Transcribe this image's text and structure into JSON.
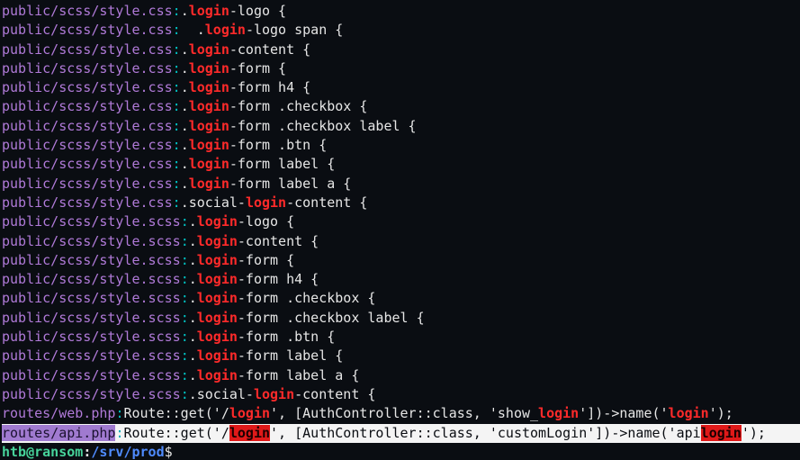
{
  "terminal": {
    "lines": [
      {
        "file": "public/scss/style.css",
        "sep": ":",
        "segments": [
          {
            "t": "."
          },
          {
            "t": "login",
            "m": true
          },
          {
            "t": "-logo {"
          }
        ]
      },
      {
        "file": "public/scss/style.css",
        "sep": ":",
        "segments": [
          {
            "t": "  ."
          },
          {
            "t": "login",
            "m": true
          },
          {
            "t": "-logo span {"
          }
        ]
      },
      {
        "file": "public/scss/style.css",
        "sep": ":",
        "segments": [
          {
            "t": "."
          },
          {
            "t": "login",
            "m": true
          },
          {
            "t": "-content {"
          }
        ]
      },
      {
        "file": "public/scss/style.css",
        "sep": ":",
        "segments": [
          {
            "t": "."
          },
          {
            "t": "login",
            "m": true
          },
          {
            "t": "-form {"
          }
        ]
      },
      {
        "file": "public/scss/style.css",
        "sep": ":",
        "segments": [
          {
            "t": "."
          },
          {
            "t": "login",
            "m": true
          },
          {
            "t": "-form h4 {"
          }
        ]
      },
      {
        "file": "public/scss/style.css",
        "sep": ":",
        "segments": [
          {
            "t": "."
          },
          {
            "t": "login",
            "m": true
          },
          {
            "t": "-form .checkbox {"
          }
        ]
      },
      {
        "file": "public/scss/style.css",
        "sep": ":",
        "segments": [
          {
            "t": "."
          },
          {
            "t": "login",
            "m": true
          },
          {
            "t": "-form .checkbox label {"
          }
        ]
      },
      {
        "file": "public/scss/style.css",
        "sep": ":",
        "segments": [
          {
            "t": "."
          },
          {
            "t": "login",
            "m": true
          },
          {
            "t": "-form .btn {"
          }
        ]
      },
      {
        "file": "public/scss/style.css",
        "sep": ":",
        "segments": [
          {
            "t": "."
          },
          {
            "t": "login",
            "m": true
          },
          {
            "t": "-form label {"
          }
        ]
      },
      {
        "file": "public/scss/style.css",
        "sep": ":",
        "segments": [
          {
            "t": "."
          },
          {
            "t": "login",
            "m": true
          },
          {
            "t": "-form label a {"
          }
        ]
      },
      {
        "file": "public/scss/style.css",
        "sep": ":",
        "segments": [
          {
            "t": ".social-"
          },
          {
            "t": "login",
            "m": true
          },
          {
            "t": "-content {"
          }
        ]
      },
      {
        "file": "public/scss/style.scss",
        "sep": ":",
        "segments": [
          {
            "t": "."
          },
          {
            "t": "login",
            "m": true
          },
          {
            "t": "-logo {"
          }
        ]
      },
      {
        "file": "public/scss/style.scss",
        "sep": ":",
        "segments": [
          {
            "t": "."
          },
          {
            "t": "login",
            "m": true
          },
          {
            "t": "-content {"
          }
        ]
      },
      {
        "file": "public/scss/style.scss",
        "sep": ":",
        "segments": [
          {
            "t": "."
          },
          {
            "t": "login",
            "m": true
          },
          {
            "t": "-form {"
          }
        ]
      },
      {
        "file": "public/scss/style.scss",
        "sep": ":",
        "segments": [
          {
            "t": "."
          },
          {
            "t": "login",
            "m": true
          },
          {
            "t": "-form h4 {"
          }
        ]
      },
      {
        "file": "public/scss/style.scss",
        "sep": ":",
        "segments": [
          {
            "t": "."
          },
          {
            "t": "login",
            "m": true
          },
          {
            "t": "-form .checkbox {"
          }
        ]
      },
      {
        "file": "public/scss/style.scss",
        "sep": ":",
        "segments": [
          {
            "t": "."
          },
          {
            "t": "login",
            "m": true
          },
          {
            "t": "-form .checkbox label {"
          }
        ]
      },
      {
        "file": "public/scss/style.scss",
        "sep": ":",
        "segments": [
          {
            "t": "."
          },
          {
            "t": "login",
            "m": true
          },
          {
            "t": "-form .btn {"
          }
        ]
      },
      {
        "file": "public/scss/style.scss",
        "sep": ":",
        "segments": [
          {
            "t": "."
          },
          {
            "t": "login",
            "m": true
          },
          {
            "t": "-form label {"
          }
        ]
      },
      {
        "file": "public/scss/style.scss",
        "sep": ":",
        "segments": [
          {
            "t": "."
          },
          {
            "t": "login",
            "m": true
          },
          {
            "t": "-form label a {"
          }
        ]
      },
      {
        "file": "public/scss/style.scss",
        "sep": ":",
        "segments": [
          {
            "t": ".social-"
          },
          {
            "t": "login",
            "m": true
          },
          {
            "t": "-content {"
          }
        ]
      },
      {
        "file": "routes/web.php",
        "sep": ":",
        "segments": [
          {
            "t": "Route::get('/"
          },
          {
            "t": "login",
            "m": true
          },
          {
            "t": "', [AuthController::class, 'show_"
          },
          {
            "t": "login",
            "m": true
          },
          {
            "t": "'])->name('"
          },
          {
            "t": "login",
            "m": true
          },
          {
            "t": "');"
          }
        ]
      },
      {
        "file": "routes/api.php",
        "sep": ":",
        "highlight": true,
        "segments": [
          {
            "t": "Route::get('/"
          },
          {
            "t": "login",
            "m": true
          },
          {
            "t": "', [AuthController::class, 'customLogin'])->name('api"
          },
          {
            "t": "login",
            "m": true
          },
          {
            "t": "');"
          }
        ]
      }
    ],
    "prompt": {
      "user_host": "htb@ransom",
      "colon": ":",
      "path": "/srv/prod",
      "symbol": "$"
    }
  }
}
